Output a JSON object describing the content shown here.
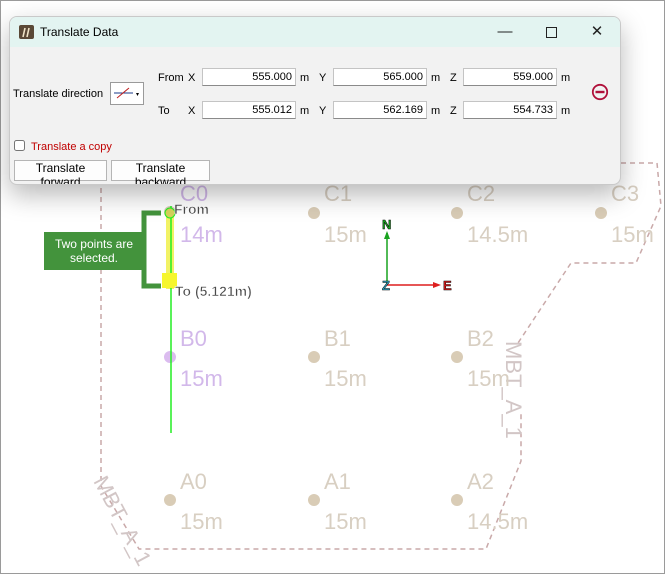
{
  "window": {
    "title": "Translate Data"
  },
  "dialog": {
    "direction_label": "Translate direction",
    "from_label": "From",
    "to_label": "To",
    "x_label": "X",
    "y_label": "Y",
    "z_label": "Z",
    "unit": "m",
    "from": {
      "x": "555.000",
      "y": "565.000",
      "z": "559.000"
    },
    "to": {
      "x": "555.012",
      "y": "562.169",
      "z": "554.733"
    },
    "copy_label": "Translate a copy",
    "forward_label": "Translate forward",
    "backward_label": "Translate backward",
    "colors": {
      "copy_text": "#c00000",
      "remove_icon": "#b0103a"
    }
  },
  "canvas": {
    "grid": [
      {
        "name": "C0",
        "size": "14m"
      },
      {
        "name": "C1",
        "size": "15m"
      },
      {
        "name": "C2",
        "size": "14.5m"
      },
      {
        "name": "C3",
        "size": "15m"
      },
      {
        "name": "B0",
        "size": "15m"
      },
      {
        "name": "B1",
        "size": "15m"
      },
      {
        "name": "B2",
        "size": "15m"
      },
      {
        "name": "A0",
        "size": "15m"
      },
      {
        "name": "A1",
        "size": "15m"
      },
      {
        "name": "A2",
        "size": "14.5m"
      }
    ],
    "from_label": "From",
    "to_label": "To (5.121m)",
    "selection_note": "Two points are selected.",
    "region_label": "MBT_A_1",
    "axes": {
      "north": "N",
      "east": "E",
      "up": "Z"
    },
    "colors": {
      "grid_point": "#d9ccb6",
      "grid_text": "#d8cfc2",
      "selected_point": "#dbbcef",
      "selected_text": "#d2b8ea",
      "move_line": "#22ee22",
      "boundary": "#c9a9a9",
      "selection_bracket": "#43933c",
      "north": "#19a31f",
      "east": "#dd1f1f",
      "up": "#2fa3c2"
    }
  }
}
